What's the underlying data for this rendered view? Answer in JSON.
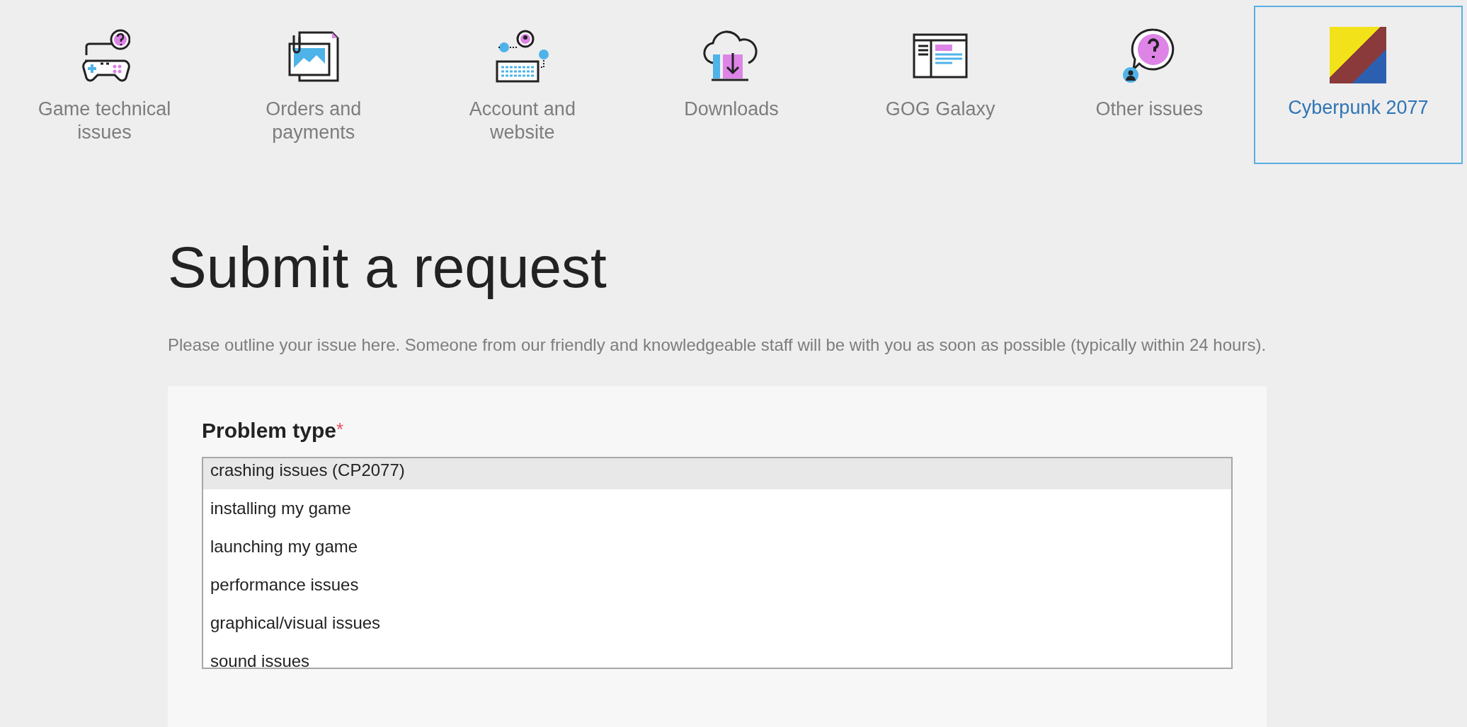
{
  "categories": [
    {
      "label": "Game technical issues",
      "selected": false
    },
    {
      "label": "Orders and payments",
      "selected": false
    },
    {
      "label": "Account and website",
      "selected": false
    },
    {
      "label": "Downloads",
      "selected": false
    },
    {
      "label": "GOG Galaxy",
      "selected": false
    },
    {
      "label": "Other issues",
      "selected": false
    },
    {
      "label": "Cyberpunk 2077",
      "selected": true
    }
  ],
  "heading": "Submit a request",
  "intro": "Please outline your issue here. Someone from our friendly and knowledgeable staff will be with you as soon as possible (typically within 24 hours).",
  "form": {
    "field_label": "Problem type",
    "required_mark": "*",
    "options": [
      {
        "label": "crashing issues (CP2077)",
        "selected": true
      },
      {
        "label": "installing my game",
        "selected": false
      },
      {
        "label": "launching my game",
        "selected": false
      },
      {
        "label": "performance issues",
        "selected": false
      },
      {
        "label": "graphical/visual issues",
        "selected": false
      },
      {
        "label": "sound issues",
        "selected": false
      }
    ]
  }
}
